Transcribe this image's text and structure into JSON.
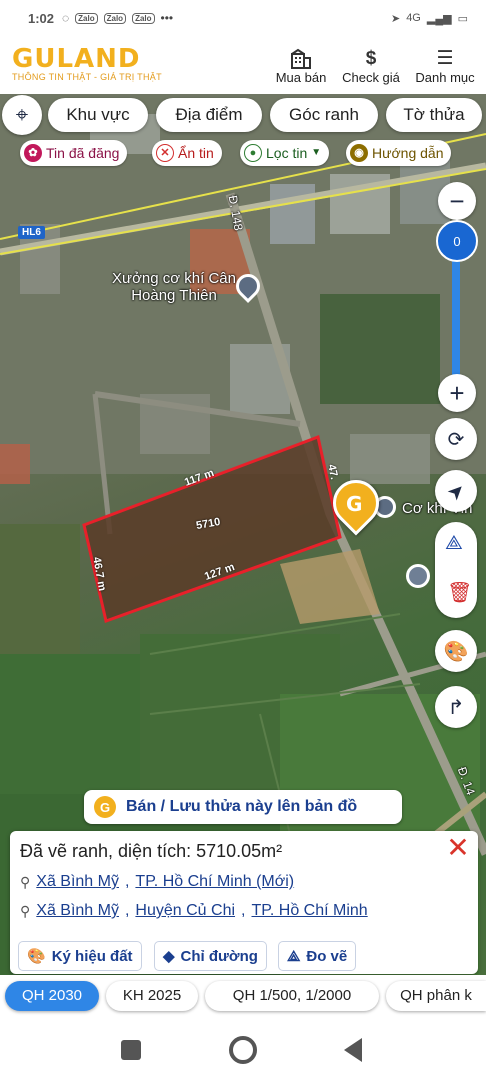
{
  "status": {
    "time": "1:02",
    "network": "4G"
  },
  "header": {
    "brand": "GULAND",
    "tagline": "THÔNG TIN THẬT - GIÁ TRỊ THẬT",
    "nav": [
      {
        "label": "Mua bán",
        "icon": "building-icon"
      },
      {
        "label": "Check giá",
        "icon": "dollar-icon"
      },
      {
        "label": "Danh mục",
        "icon": "menu-icon"
      }
    ]
  },
  "map": {
    "filters": [
      "Khu vực",
      "Địa điểm",
      "Góc ranh",
      "Tờ thửa"
    ],
    "chips": [
      {
        "label": "Tin đã đăng",
        "color": "#c2185b"
      },
      {
        "label": "Ẩn tin",
        "color": "#d32f2f"
      },
      {
        "label": "Lọc tin",
        "color": "#2e7d32"
      },
      {
        "label": "Hướng dẫn",
        "color": "#8d6e00"
      }
    ],
    "zoom_value": "0",
    "road_label": "HL6",
    "road_label2": "Đ. 148",
    "road_label3": "Đ. 14",
    "poi_1": "Xưởng cơ khí Cân Hoàng Thiên",
    "poi_2": "Cơ khí Vin",
    "plot": {
      "area_label": "5710",
      "side_top": "117 m",
      "side_bottom": "127 m",
      "side_left": "46.7 m",
      "side_right": "47."
    },
    "sell_button": "Bán / Lưu thửa này lên bản đồ"
  },
  "info": {
    "title": "Đã vẽ ranh, diện tích: 5710.05m²",
    "addr1": {
      "commune": "Xã Bình Mỹ",
      "city": "TP. Hồ Chí Minh (Mới)"
    },
    "addr2": {
      "commune": "Xã Bình Mỹ",
      "district": "Huyện Củ Chi",
      "city": "TP. Hồ Chí Minh"
    },
    "actions": [
      "Ký hiệu đất",
      "Chỉ đường",
      "Đo vẽ"
    ]
  },
  "plan_tabs": [
    "QH 2030",
    "KH 2025",
    "QH 1/500, 1/2000",
    "QH phân k"
  ],
  "colors": {
    "brand": "#f2b01e",
    "accent": "#2f86e6",
    "plot_border": "#e8202a",
    "link": "#1b3f8f"
  }
}
